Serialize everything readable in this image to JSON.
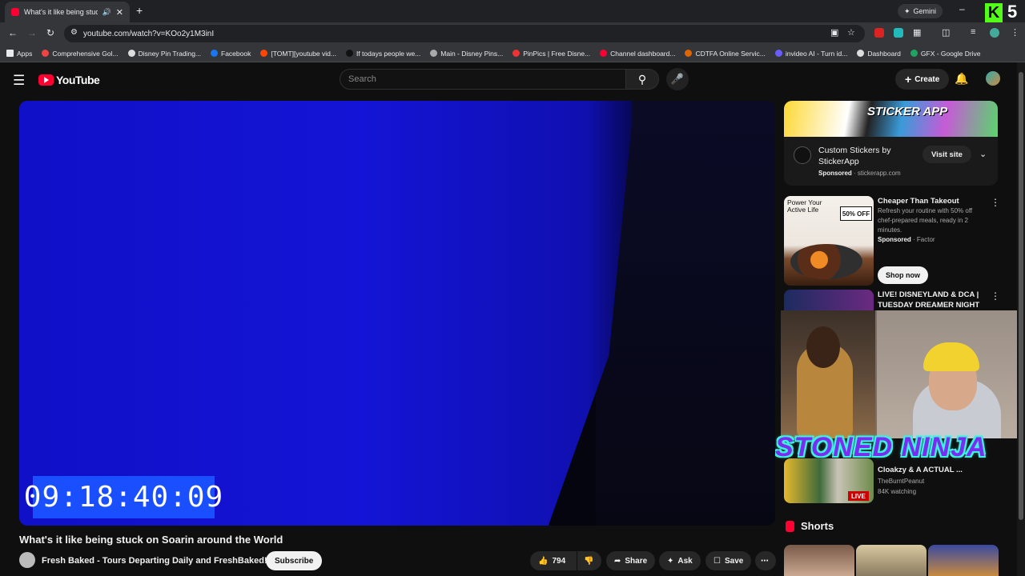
{
  "browser": {
    "tab_title": "What's it like being stuck o",
    "url": "youtube.com/watch?v=KOo2y1M3inI",
    "gemini": "Gemini",
    "corner_number": "5",
    "corner_letter": "K",
    "bookmarks": [
      {
        "label": "Apps",
        "color": "#e8eaed"
      },
      {
        "label": "Comprehensive Gol...",
        "color": "#e44"
      },
      {
        "label": "Disney Pin Trading...",
        "color": "#ddd"
      },
      {
        "label": "Facebook",
        "color": "#1877f2"
      },
      {
        "label": "[TOMT][youtube vid...",
        "color": "#ff4500"
      },
      {
        "label": "If todays people we...",
        "color": "#111"
      },
      {
        "label": "Main - Disney Pins...",
        "color": "#aaa"
      },
      {
        "label": "PinPics | Free Disne...",
        "color": "#e33"
      },
      {
        "label": "Channel dashboard...",
        "color": "#ff0033"
      },
      {
        "label": "CDTFA Online Servic...",
        "color": "#d60"
      },
      {
        "label": "invideo AI - Turn id...",
        "color": "#6a5cff"
      },
      {
        "label": "Dashboard",
        "color": "#ddd"
      },
      {
        "label": "GFX - Google Drive",
        "color": "#1fa463"
      }
    ]
  },
  "youtube": {
    "logo_text": "YouTube",
    "search_placeholder": "Search",
    "create_label": "Create"
  },
  "video": {
    "timer": "09:18:40:09",
    "title": "What's it like being stuck on Soarin around the World",
    "channel": "Fresh Baked - Tours Departing Daily and FreshBaked!",
    "subscribe": "Subscribe",
    "likes": "794",
    "share": "Share",
    "ask": "Ask",
    "save": "Save"
  },
  "sidebar": {
    "ad1": {
      "banner_brand": "STICKER APP",
      "title": "Custom Stickers by StickerApp",
      "sponsored": "Sponsored",
      "domain": "stickerapp.com",
      "visit": "Visit site"
    },
    "ad2": {
      "thumb_text": "Power Your Active Life",
      "thumb_offer": "50% OFF",
      "title": "Cheaper Than Takeout",
      "desc": "Refresh your routine with 50% off chef-prepared meals, ready in 2 minutes.",
      "sponsored": "Sponsored",
      "advertiser": "Factor",
      "shop": "Shop now"
    },
    "video1": {
      "title": "LIVE! DISNEYLAND & DCA | TUESDAY DREAMER NIGHT ..."
    },
    "video2": {
      "title": "Cloakzy & A ACTUAL ...",
      "channel": "TheBurntPeanut",
      "watching": "84K watching",
      "live": "LIVE"
    },
    "overlay_text": "STONED NINJA",
    "shorts_label": "Shorts"
  }
}
